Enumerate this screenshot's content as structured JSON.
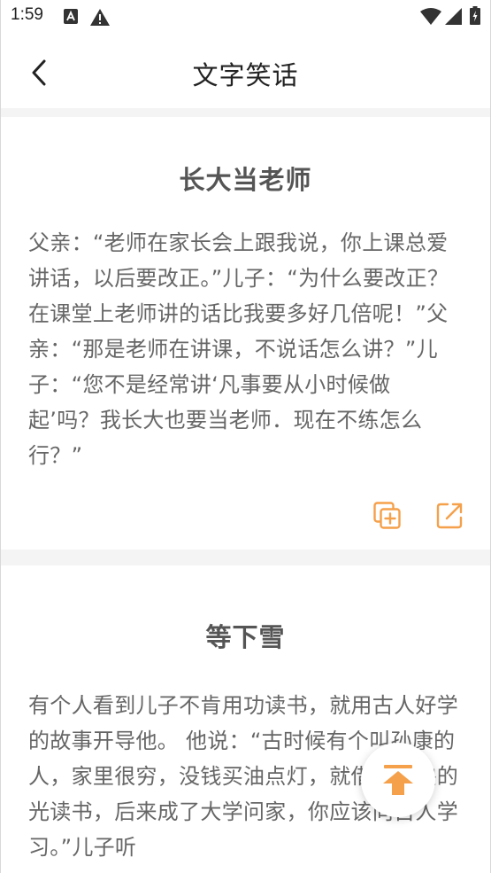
{
  "status_bar": {
    "time": "1:59",
    "icons": [
      "a-box-icon",
      "warning-icon",
      "wifi-icon",
      "signal-icon",
      "battery-icon"
    ]
  },
  "app_bar": {
    "title": "文字笑话",
    "back_icon": "chevron-left-icon"
  },
  "accent_color": "#f5a04a",
  "jokes": [
    {
      "title": "长大当老师",
      "body": "父亲：“老师在家长会上跟我说，你上课总爱讲话，以后要改正。”儿子：“为什么要改正？在课堂上老师讲的话比我要多好几倍呢！”父亲：“那是老师在讲课，不说话怎么讲？”儿子：“您不是经常讲‘凡事要从小时候做起’吗？我长大也要当老师．现在不练怎么行？”",
      "actions": [
        "copy-icon",
        "share-icon"
      ]
    },
    {
      "title": "等下雪",
      "body": "有个人看到儿子不肯用功读书，就用古人好学的故事开导他。 他说：“古时候有个叫孙康的人，家里很穷，没钱买油点灯，就借着雪映的光读书，后来成了大学问家，你应该向古人学习。”儿子听"
    }
  ],
  "fab": {
    "icon": "arrow-up-to-top-icon"
  }
}
